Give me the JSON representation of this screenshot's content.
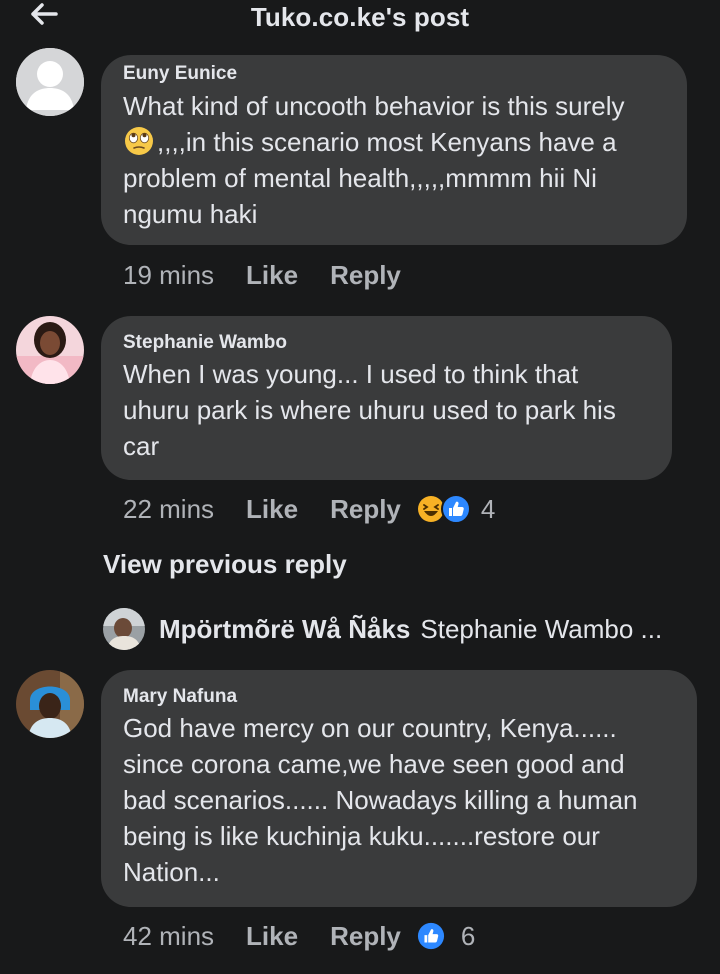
{
  "header": {
    "title": "Tuko.co.ke's post",
    "back_icon": "arrow-left-icon"
  },
  "comments": [
    {
      "author": "Euny Eunice",
      "lines": [
        "What kind of uncooth behavior is this surely",
        ",,,,in this scenario most Kenyans have a",
        "problem of mental health,,,,,mmmm hii Ni",
        "ngumu haki"
      ],
      "time": "19 mins",
      "like": "Like",
      "reply": "Reply"
    },
    {
      "author": "Stephanie Wambo",
      "lines": [
        "When I was young... I used to think that",
        "uhuru park is where uhuru used to park his",
        "car"
      ],
      "time": "22 mins",
      "like": "Like",
      "reply": "Reply",
      "reaction_count": "4"
    },
    {
      "author": "Mary Nafuna",
      "lines": [
        "God have mercy on our country, Kenya......",
        "since corona came,we have seen good and",
        "bad scenarios...... Nowadays killing a human",
        "being is like kuchinja kuku.......restore our",
        "Nation..."
      ],
      "time": "42 mins",
      "like": "Like",
      "reply": "Reply",
      "reaction_count": "6"
    }
  ],
  "view_previous": "View previous reply",
  "reply_preview": {
    "name": "Mpörtmõrë Wå Ñåks",
    "text": "Stephanie Wambo ..."
  },
  "colors": {
    "background": "#18191a",
    "bubble": "#3a3b3c",
    "text": "#e4e6eb",
    "secondary": "#b0b3b8",
    "like_blue": "#2d88ff",
    "haha_yellow": "#f7b125"
  }
}
